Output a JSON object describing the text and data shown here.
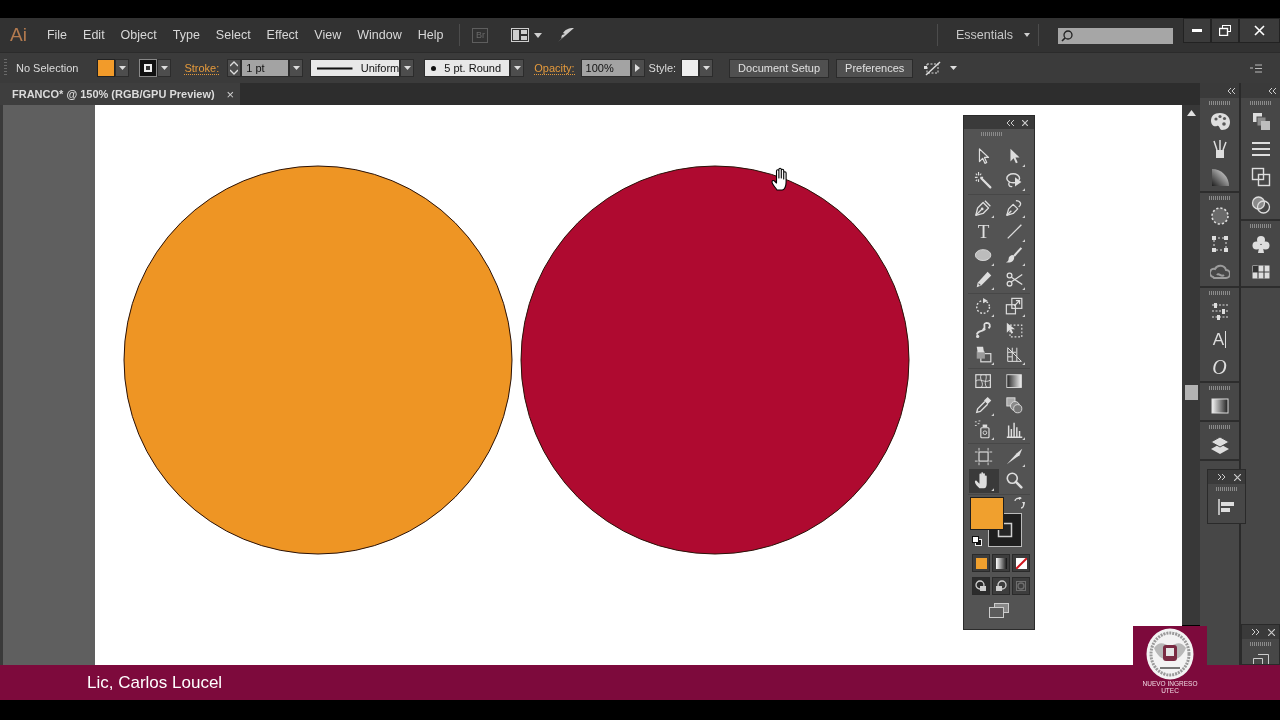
{
  "menu_bar": {
    "logo": "Ai",
    "items": [
      "File",
      "Edit",
      "Object",
      "Type",
      "Select",
      "Effect",
      "View",
      "Window",
      "Help"
    ],
    "bridge": "Br",
    "workspace": "Essentials"
  },
  "control_bar": {
    "selection": "No Selection",
    "fill": {
      "color": "#f29b2a"
    },
    "stroke_label": "Stroke:",
    "stroke_weight": "1 pt",
    "stroke_profile": "Uniform",
    "brush": "5 pt. Round",
    "opacity_label": "Opacity:",
    "opacity": "100%",
    "style_label": "Style:",
    "buttons": [
      "Document Setup",
      "Preferences"
    ]
  },
  "document_tab": {
    "title": "FRANCO* @ 150% (RGB/GPU Preview)",
    "close": "×"
  },
  "artboard": {
    "shapes": [
      {
        "kind": "circle",
        "color": "#ee9524"
      },
      {
        "kind": "circle",
        "color": "#af0a30"
      }
    ]
  },
  "toolbox": {
    "tools": [
      {
        "selected": false
      },
      {
        "selected": false
      },
      {
        "selected": false
      },
      {
        "selected": false
      },
      {
        "selected": false
      },
      {
        "selected": false
      },
      {
        "glyph": "T",
        "selected": false
      },
      {
        "selected": false
      },
      {
        "selected": false
      },
      {
        "selected": false
      },
      {
        "selected": false
      },
      {
        "selected": false
      },
      {
        "selected": false
      },
      {
        "selected": false
      },
      {
        "selected": false
      },
      {
        "selected": false
      },
      {
        "selected": false
      },
      {
        "selected": false
      },
      {
        "selected": false
      },
      {
        "selected": false
      },
      {
        "selected": false
      },
      {
        "selected": false
      },
      {
        "selected": false
      },
      {
        "selected": false
      },
      {
        "selected": false
      },
      {
        "selected": false
      },
      {
        "selected": true
      },
      {
        "selected": false
      }
    ],
    "fill": {
      "color": "#f0a02e"
    },
    "draw_modes": [
      {
        "selected": true,
        "disabled": false
      },
      {
        "selected": false,
        "disabled": false
      },
      {
        "selected": false,
        "disabled": true
      }
    ]
  },
  "dock": {
    "character_glyph": "A",
    "opentype_glyph": "O"
  },
  "caption": {
    "text": "Lic, Carlos Loucel"
  },
  "badge": {
    "lines": [
      "NUEVO INGRESO",
      "UTEC"
    ]
  }
}
